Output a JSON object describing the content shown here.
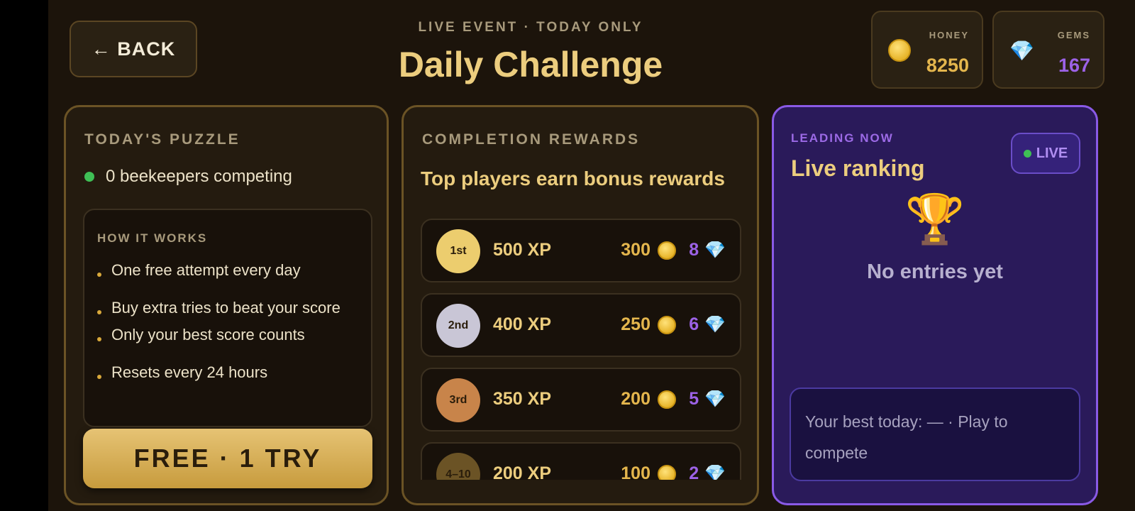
{
  "header": {
    "back_label": "← BACK",
    "eyebrow": "LIVE EVENT · TODAY ONLY",
    "title": "Daily Challenge"
  },
  "currencies": [
    {
      "label": "HONEY",
      "value": "8250",
      "icon": "coin-icon",
      "color": "#e4b64d"
    },
    {
      "label": "GEMS",
      "value": "167",
      "icon": "gem-icon",
      "color": "#9c62e6"
    }
  ],
  "puzzle": {
    "heading": "TODAY'S PUZZLE",
    "competing": "0 beekeepers competing",
    "how_title": "HOW IT WORKS",
    "rules": [
      "One free attempt every day",
      "Buy extra tries to beat your score",
      "Only your best score counts",
      "Resets every 24 hours"
    ],
    "button_label": "FREE · 1 TRY"
  },
  "rewards": {
    "heading": "COMPLETION REWARDS",
    "subtitle": "Top players earn bonus rewards",
    "rows": [
      {
        "rank": "1st",
        "xp": "500 XP",
        "honey": "300",
        "gems": "8",
        "medal_color": "#eccd6e"
      },
      {
        "rank": "2nd",
        "xp": "400 XP",
        "honey": "250",
        "gems": "6",
        "medal_color": "#c9c6d6"
      },
      {
        "rank": "3rd",
        "xp": "350 XP",
        "honey": "200",
        "gems": "5",
        "medal_color": "#c8844a"
      },
      {
        "rank": "4–10",
        "xp": "200 XP",
        "honey": "100",
        "gems": "2",
        "medal_color": "#6b5325"
      }
    ]
  },
  "live": {
    "eyebrow": "LEADING NOW",
    "title": "Live ranking",
    "badge": "LIVE",
    "empty_text": "No entries yet",
    "best_text": "Your best today: — · Play to compete"
  }
}
